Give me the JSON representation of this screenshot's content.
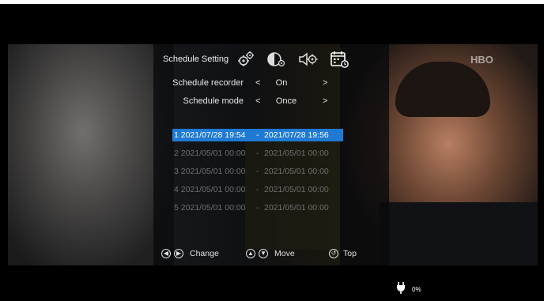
{
  "panel": {
    "title": "Schedule Setting",
    "tabs": [
      {
        "icon": "gears-icon"
      },
      {
        "icon": "display-settings-icon"
      },
      {
        "icon": "audio-settings-icon"
      },
      {
        "icon": "schedule-calendar-icon",
        "active": true
      }
    ]
  },
  "settings": [
    {
      "label": "Schedule recorder",
      "value": "On",
      "left_arrow": "<",
      "right_arrow": ">"
    },
    {
      "label": "Schedule mode",
      "value": "Once",
      "left_arrow": "<",
      "right_arrow": ">"
    }
  ],
  "schedules": [
    {
      "start": "1 2021/07/28 19:54",
      "dash": "-",
      "end": "2021/07/28 19:56",
      "selected": true
    },
    {
      "start": "2 2021/05/01 00:00",
      "dash": "-",
      "end": "2021/05/01 00:00",
      "selected": false
    },
    {
      "start": "3 2021/05/01 00:00",
      "dash": "-",
      "end": "2021/05/01 00:00",
      "selected": false
    },
    {
      "start": "4 2021/05/01 00:00",
      "dash": "-",
      "end": "2021/05/01 00:00",
      "selected": false
    },
    {
      "start": "5 2021/05/01 00:00",
      "dash": "-",
      "end": "2021/05/01 00:00",
      "selected": false
    }
  ],
  "hints": {
    "change": "Change",
    "move": "Move",
    "top": "Top"
  },
  "video": {
    "watermark": "HBO"
  },
  "status": {
    "battery_text": "0%"
  },
  "colors": {
    "selection": "#1f7ad4",
    "panel_bg": "#08090b"
  }
}
